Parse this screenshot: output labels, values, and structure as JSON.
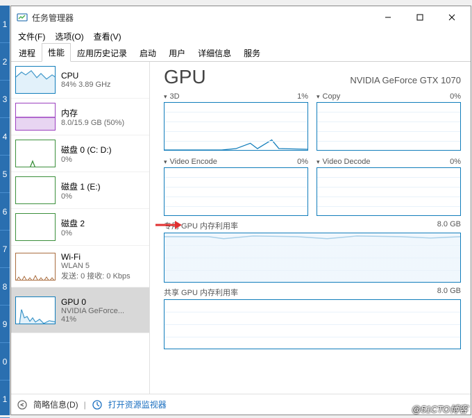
{
  "window": {
    "title": "任务管理器",
    "minimize": "—",
    "maximize": "☐",
    "close": "✕"
  },
  "menu": {
    "file": "文件(F)",
    "options": "选项(O)",
    "view": "查看(V)"
  },
  "tabs": {
    "processes": "进程",
    "performance": "性能",
    "apphistory": "应用历史记录",
    "startup": "启动",
    "users": "用户",
    "details": "详细信息",
    "services": "服务"
  },
  "sidebar": [
    {
      "title": "CPU",
      "line2": "84% 3.89 GHz"
    },
    {
      "title": "内存",
      "line2": "8.0/15.9 GB (50%)"
    },
    {
      "title": "磁盘 0 (C: D:)",
      "line2": "0%"
    },
    {
      "title": "磁盘 1 (E:)",
      "line2": "0%"
    },
    {
      "title": "磁盘 2",
      "line2": "0%"
    },
    {
      "title": "Wi-Fi",
      "line2": "WLAN 5",
      "line3": "发送: 0 接收: 0 Kbps"
    },
    {
      "title": "GPU 0",
      "line2": "NVIDIA GeForce...",
      "line3": "41%"
    }
  ],
  "detail": {
    "heading": "GPU",
    "model": "NVIDIA GeForce GTX 1070",
    "charts": [
      {
        "label": "3D",
        "value": "1%"
      },
      {
        "label": "Copy",
        "value": "0%"
      },
      {
        "label": "Video Encode",
        "value": "0%"
      },
      {
        "label": "Video Decode",
        "value": "0%"
      }
    ],
    "dedicated": {
      "label": "专用 GPU 内存利用率",
      "max": "8.0 GB"
    },
    "shared": {
      "label": "共享 GPU 内存利用率",
      "max": "8.0 GB"
    }
  },
  "statusbar": {
    "less": "简略信息(D)",
    "resmon": "打开资源监视器"
  },
  "watermark": "@51CTO博客",
  "numstrip": [
    "1",
    "2",
    "3",
    "4",
    "5",
    "6",
    "7",
    "8",
    "9",
    "0",
    "1"
  ],
  "chart_data": {
    "type": "line",
    "title": "GPU",
    "series": [
      {
        "name": "3D",
        "values_pct": [
          0,
          0,
          0,
          0,
          0,
          0,
          0,
          0,
          0,
          1,
          6,
          2,
          1,
          1,
          1
        ]
      },
      {
        "name": "Copy",
        "values_pct": [
          0,
          0,
          0,
          0,
          0,
          0,
          0,
          0,
          0,
          0,
          0,
          0,
          0,
          0,
          0
        ]
      },
      {
        "name": "Video Encode",
        "values_pct": [
          0,
          0,
          0,
          0,
          0,
          0,
          0,
          0,
          0,
          0,
          0,
          0,
          0,
          0,
          0
        ]
      },
      {
        "name": "Video Decode",
        "values_pct": [
          0,
          0,
          0,
          0,
          0,
          0,
          0,
          0,
          0,
          0,
          0,
          0,
          0,
          0,
          0
        ]
      },
      {
        "name": "专用 GPU 内存利用率 (GB)",
        "ymax": 8.0,
        "values": [
          7.7,
          7.7,
          7.7,
          7.7,
          7.6,
          7.7,
          7.7,
          7.7,
          7.6,
          7.7,
          7.7,
          7.7,
          7.7,
          7.7,
          7.7
        ]
      },
      {
        "name": "共享 GPU 内存利用率 (GB)",
        "ymax": 8.0,
        "values": [
          0,
          0,
          0,
          0,
          0,
          0,
          0,
          0,
          0,
          0,
          0,
          0,
          0,
          0,
          0
        ]
      }
    ]
  }
}
